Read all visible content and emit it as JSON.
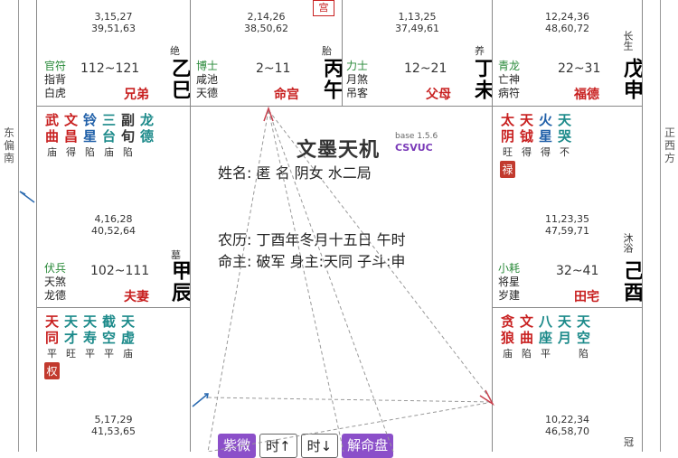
{
  "side": {
    "left": "东偏南",
    "right": "正西方"
  },
  "top_seal": "宫",
  "cells": {
    "si": {
      "nums": [
        "3,15,27",
        "39,51,63"
      ],
      "state": "绝",
      "gods": [
        "官符",
        "指背",
        "白虎"
      ],
      "range": "112~121",
      "ganzhi": "乙巳",
      "palace": "兄弟"
    },
    "wu": {
      "nums": [
        "2,14,26",
        "38,50,62"
      ],
      "state": "胎",
      "gods": [
        "博士",
        "咸池",
        "天德"
      ],
      "range": "2~11",
      "ganzhi": "丙午",
      "palace": "命宫"
    },
    "wei": {
      "nums": [
        "1,13,25",
        "37,49,61"
      ],
      "state": "养",
      "gods": [
        "力士",
        "月煞",
        "吊客"
      ],
      "range": "12~21",
      "ganzhi": "丁未",
      "palace": "父母"
    },
    "shen": {
      "nums": [
        "12,24,36",
        "48,60,72"
      ],
      "state": "长生",
      "gods": [
        "青龙",
        "亡神",
        "病符"
      ],
      "range": "22~31",
      "ganzhi": "戊申",
      "palace": "福德"
    },
    "chen": {
      "stars": [
        [
          "武",
          "曲",
          "庙"
        ],
        [
          "文",
          "昌",
          "得"
        ],
        [
          "铃",
          "星",
          "陷"
        ],
        [
          "三",
          "台",
          "庙"
        ],
        [
          "副",
          "旬",
          "陷"
        ],
        [
          "龙",
          "德",
          ""
        ]
      ],
      "nums": [
        "4,16,28",
        "40,52,64"
      ],
      "state": "墓",
      "gods": [
        "伏兵",
        "天煞",
        "龙德"
      ],
      "range": "102~111",
      "ganzhi": "甲辰",
      "palace": "夫妻"
    },
    "you": {
      "stars": [
        [
          "太",
          "阴",
          "旺"
        ],
        [
          "天",
          "钺",
          "得"
        ],
        [
          "火",
          "星",
          "得"
        ],
        [
          "天",
          "哭",
          "不"
        ]
      ],
      "hua": "禄",
      "nums": [
        "11,23,35",
        "47,59,71"
      ],
      "state": "沐浴",
      "gods": [
        "小耗",
        "将星",
        "岁建"
      ],
      "range": "32~41",
      "ganzhi": "己酉",
      "palace": "田宅"
    },
    "mao": {
      "stars": [
        [
          "天",
          "同",
          "平"
        ],
        [
          "天",
          "才",
          "旺"
        ],
        [
          "天",
          "寿",
          "平"
        ],
        [
          "截",
          "空",
          "平"
        ],
        [
          "天",
          "虚",
          "庙"
        ]
      ],
      "hua": "权",
      "nums": [
        "5,17,29",
        "41,53,65"
      ]
    },
    "xu": {
      "stars": [
        [
          "贪",
          "狼",
          "庙"
        ],
        [
          "文",
          "曲",
          "陷"
        ],
        [
          "八",
          "座",
          "平"
        ],
        [
          "天",
          "月",
          ""
        ],
        [
          "天",
          "空",
          "陷"
        ]
      ],
      "nums": [
        "10,22,34",
        "46,58,70"
      ],
      "state": "冠"
    }
  },
  "center": {
    "title": "文墨天机",
    "version": "base 1.5.6",
    "brand": "CSVUC",
    "line1": "姓名: 匿 名        阴女  水二局",
    "line2": "农历: 丁酉年冬月十五日  午时",
    "line3": "命主: 破军  身主:天同  子斗:申",
    "buttons": [
      "紫微",
      "时↑",
      "时↓",
      "解命盘"
    ]
  }
}
